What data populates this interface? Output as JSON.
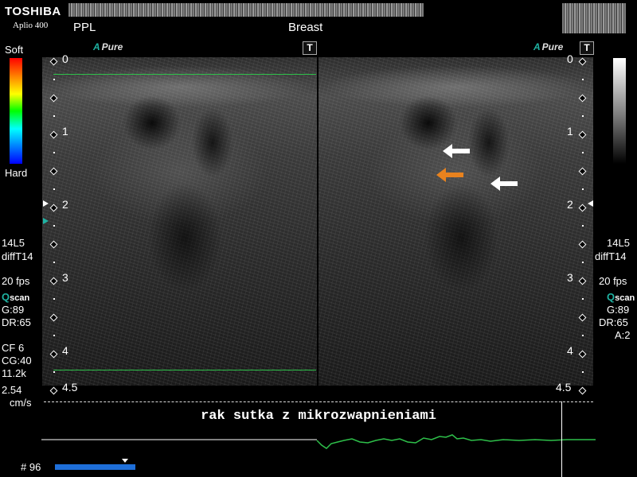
{
  "header": {
    "brand": "TOSHIBA",
    "model": "Aplio 400",
    "operator": "PPL",
    "preset": "Breast"
  },
  "imaging": {
    "left_mode": "Pure",
    "right_mode": "Pure",
    "toggle_label": "T",
    "elasticity_top": "Soft",
    "elasticity_bottom": "Hard",
    "depth_marks": [
      "0",
      "1",
      "2",
      "3",
      "4",
      "4.5"
    ]
  },
  "left_panel": {
    "probe": "14L5",
    "preset": "diffT14",
    "fps": "20 fps",
    "q": "Q",
    "scan": "scan",
    "gain": "G:89",
    "dr": "DR:65",
    "cf": "CF 6",
    "cg": "CG:40",
    "prf": "11.2k",
    "velocity": "2.54",
    "velocity_unit": "cm/s"
  },
  "right_panel": {
    "probe": "14L5",
    "preset": "diffT14",
    "fps": "20 fps",
    "q": "Q",
    "scan": "scan",
    "gain": "G:89",
    "dr": "DR:65",
    "a": "A:2"
  },
  "caption": "rak sutka z mikrozwapnieniami",
  "frame": {
    "label": "# 96"
  },
  "colors": {
    "arrow_white": "#ffffff",
    "arrow_orange": "#e8821e",
    "trace": "#2ec04a",
    "frame_bar": "#1e6fd9",
    "accent": "#1fb3a3"
  }
}
